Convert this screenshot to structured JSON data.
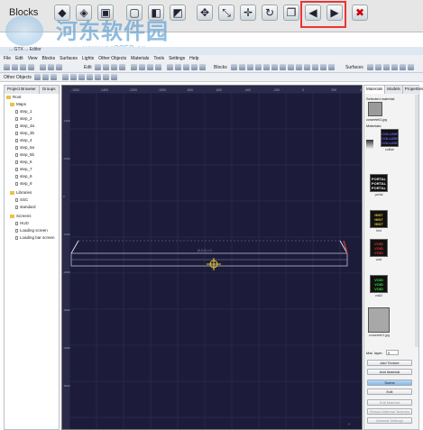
{
  "zoom_toolbar": {
    "blocks_label": "Blocks"
  },
  "watermark": {
    "title": "河东软件园",
    "url": "www.pc0359.cn"
  },
  "window": {
    "title": "... GTX ... Editor"
  },
  "menu": [
    "File",
    "Edit",
    "View",
    "Blocks",
    "Surfaces",
    "Lights",
    "Other Objects",
    "Materials",
    "Tools",
    "Settings",
    "Help"
  ],
  "toolbar": {
    "edit_label": "Edit",
    "blocks_label": "Blocks",
    "surfaces_label": "Surfaces",
    "other_objects_label": "Other Objects"
  },
  "left_panel": {
    "tabs": [
      "Project Browser",
      "Groups"
    ],
    "tree": {
      "root": "Root",
      "maps_folder": "Maps",
      "maps": [
        "step_1",
        "step_2",
        "step_3a",
        "step_3b",
        "step_4",
        "step_5a",
        "step_5b",
        "step_6",
        "step_7",
        "step_8",
        "step_9"
      ],
      "libraries_folder": "Libraries",
      "libraries": [
        "SSC",
        "standard"
      ],
      "screens_folder": "Screens",
      "screens": [
        "HUD",
        "Loading screen",
        "Loading bar screen"
      ]
    }
  },
  "viewport": {
    "ruler_top": [
      "-1600",
      "-1400",
      "-1200",
      "-1000",
      "-800",
      "-600",
      "-400",
      "-200",
      "0",
      "200",
      "400"
    ],
    "ruler_left": [
      "-1200",
      "-1000",
      "0",
      "-1000",
      "-2000",
      "-3000",
      "-4000",
      "-5000"
    ],
    "measure_label": "(0,0,0) x 0"
  },
  "right_panel": {
    "tabs": [
      "Materials",
      "Models",
      "Properties"
    ],
    "selected_material_label": "Selected material:",
    "selected_material_name": "concrete01.jpg",
    "materials_label": "Materials:",
    "materials": [
      {
        "name": "collide",
        "lines": [
          "COLLIDE",
          "COLLIDE",
          "COLLIDE"
        ],
        "color": "#6a6aff"
      },
      {
        "name": "portal",
        "lines": [
          "PORTAL",
          "PORTAL",
          "PORTAL"
        ],
        "color": "#f0f0f0"
      },
      {
        "name": "hint",
        "lines": [
          "HINT",
          "HINT",
          "HINT"
        ],
        "color": "#e0c030"
      },
      {
        "name": "void",
        "lines": [
          "VOID",
          "VOID",
          "VOID"
        ],
        "color": "#e03030"
      },
      {
        "name": "void2",
        "lines": [
          "VOID",
          "VOID",
          "VOID"
        ],
        "color": "#30e030"
      },
      {
        "name": "concrete01.jpg",
        "lines": [],
        "color": "#aaaaaa"
      }
    ],
    "mat_layer_label": "Mat. layer:",
    "mat_layer_value": "0",
    "buttons": [
      "Add Texture",
      "Add Material",
      "Scene",
      "Edit",
      "Edit Material",
      "Reload Material Textures",
      "Material Settings"
    ]
  }
}
